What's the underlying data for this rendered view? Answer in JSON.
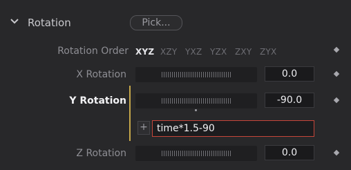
{
  "section": {
    "title": "Rotation",
    "pick_label": "Pick..."
  },
  "rotation_order": {
    "label": "Rotation Order",
    "options": [
      "XYZ",
      "XZY",
      "YXZ",
      "YZX",
      "ZXY",
      "ZYX"
    ],
    "selected": "XYZ"
  },
  "x_rotation": {
    "label": "X Rotation",
    "value": "0.0"
  },
  "y_rotation": {
    "label": "Y Rotation",
    "value": "-90.0",
    "expression": "time*1.5-90",
    "add_label": "+"
  },
  "z_rotation": {
    "label": "Z Rotation",
    "value": "0.0"
  },
  "colors": {
    "accent_marker": "#c7a84a",
    "expression_border": "#c6463a"
  }
}
